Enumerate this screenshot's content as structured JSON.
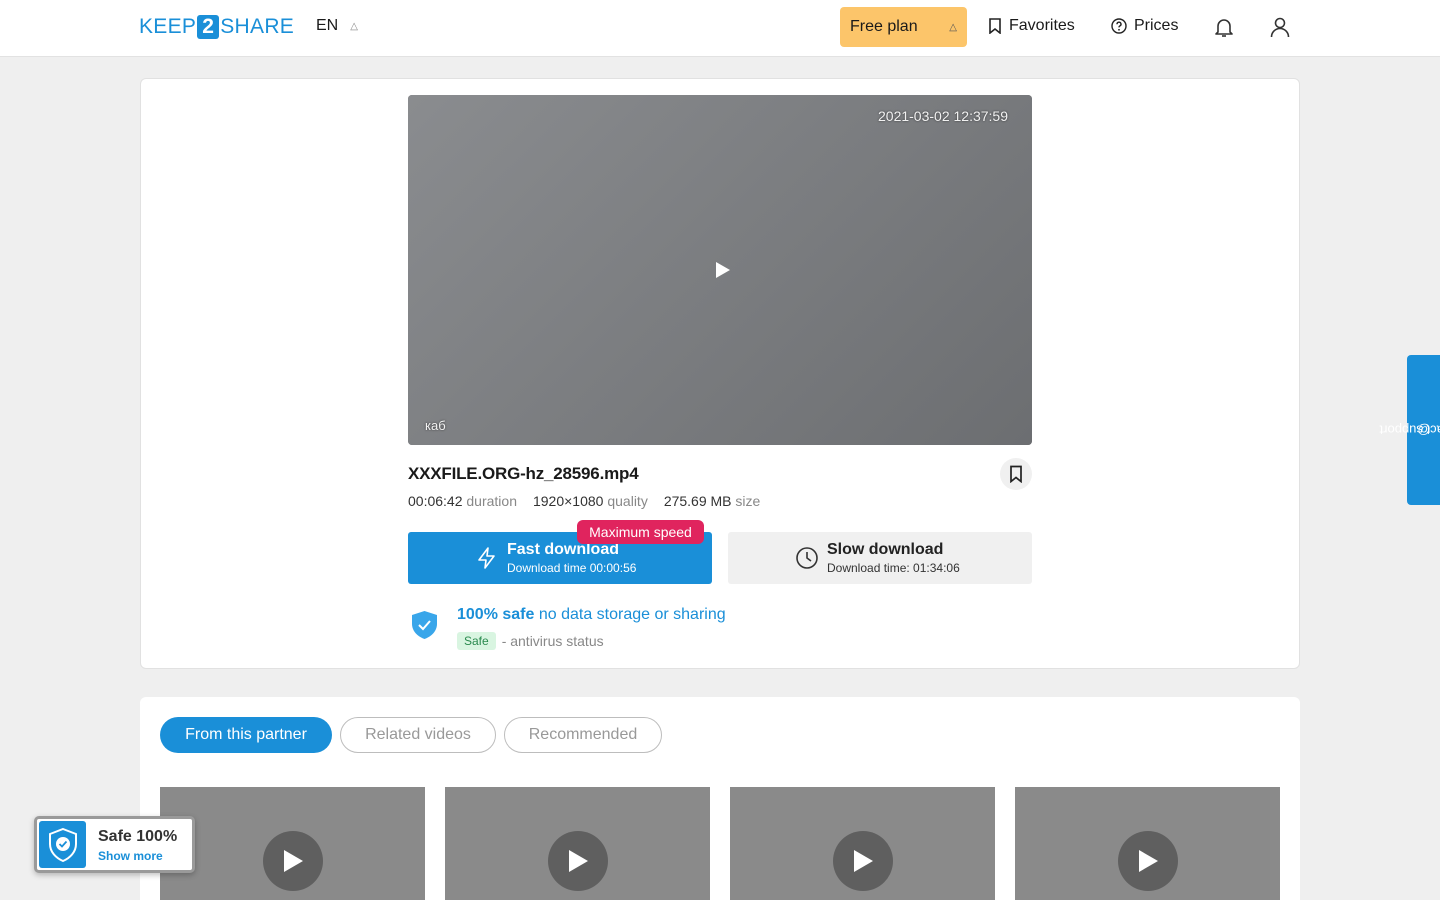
{
  "header": {
    "logo_left": "KEEP",
    "logo_mid": "2",
    "logo_right": "SHARE",
    "language": "EN",
    "plan_label": "Free plan",
    "favorites_label": "Favorites",
    "prices_label": "Prices"
  },
  "player": {
    "timestamp": "2021-03-02 12:37:59",
    "overlay_text": "каб"
  },
  "file": {
    "name": "XXXFILE.ORG-hz_28596.mp4",
    "duration": "00:06:42",
    "duration_label": "duration",
    "quality": "1920×1080",
    "quality_label": "quality",
    "size": "275.69 MB",
    "size_label": "size"
  },
  "downloads": {
    "fast_label": "Fast download",
    "fast_time": "Download time 00:00:56",
    "fast_badge": "Maximum speed",
    "slow_label": "Slow download",
    "slow_time": "Download time: 01:34:06"
  },
  "safety": {
    "headline_bold": "100% safe",
    "headline_rest": "no data storage or sharing",
    "av_badge": "Safe",
    "av_text": "- antivirus status"
  },
  "support": {
    "label": "contact support"
  },
  "tabs": [
    {
      "label": "From this partner",
      "active": true
    },
    {
      "label": "Related videos",
      "active": false
    },
    {
      "label": "Recommended",
      "active": false
    }
  ],
  "safe_popup": {
    "title": "Safe 100%",
    "link": "Show more"
  },
  "colors": {
    "accent": "#1a8fd8",
    "plan": "#fcc56a",
    "badge": "#e0245e"
  }
}
